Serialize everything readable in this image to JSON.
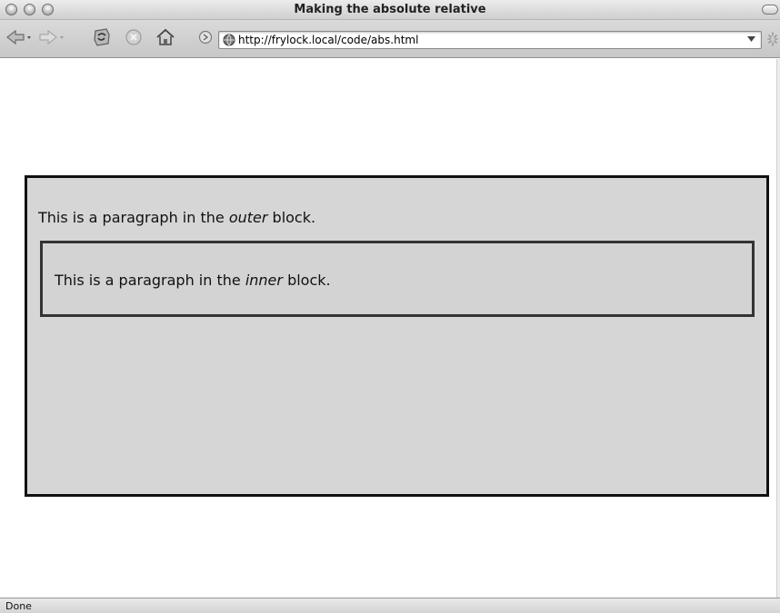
{
  "window": {
    "title": "Making the absolute relative"
  },
  "toolbar": {
    "url": "http://frylock.local/code/abs.html",
    "icons": [
      "back-arrow-icon",
      "forward-arrow-icon",
      "reload-icon",
      "stop-icon",
      "home-icon",
      "go-icon",
      "globe-icon",
      "dropdown-icon",
      "throbber-icon"
    ]
  },
  "page": {
    "outer_text_before": "This is a paragraph in the ",
    "outer_emphasis": "outer",
    "outer_text_after": " block.",
    "inner_text_before": "This is a paragraph in the ",
    "inner_emphasis": "inner",
    "inner_text_after": " block."
  },
  "status": {
    "text": "Done"
  },
  "colors": {
    "outer_background": "#d6d6d6",
    "border": "#111111"
  }
}
